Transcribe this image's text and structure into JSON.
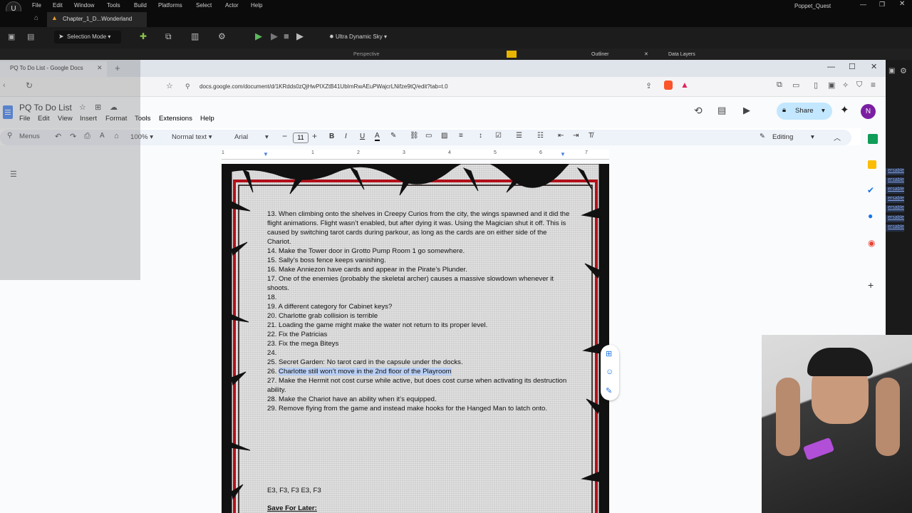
{
  "unreal": {
    "menu": [
      "File",
      "Edit",
      "Window",
      "Tools",
      "Build",
      "Platforms",
      "Select",
      "Actor",
      "Help"
    ],
    "tab_title": "Chapter_1_D...Wonderland",
    "project": "Poppet_Quest",
    "selection_mode": "Selection Mode",
    "sky": "Ultra Dynamic Sky",
    "perspective": "Perspective",
    "outliner": "Outliner",
    "data_layers": "Data Layers",
    "link_labels": [
      "ersable",
      "ersable",
      "ersable",
      "ersable",
      "ersable",
      "ersable",
      "ersable"
    ]
  },
  "browser": {
    "tab_title": "PQ To Do List - Google Docs",
    "url": "docs.google.com/document/d/1KRdds0zQjHwPIXZtB41UbImRwAEuPWajcrLNifze9tQ/edit?tab=t.0"
  },
  "docs": {
    "title": "PQ To Do List",
    "menu": [
      "File",
      "Edit",
      "View",
      "Insert",
      "Format",
      "Tools",
      "Extensions",
      "Help"
    ],
    "share": "Share",
    "avatar": "N",
    "menus": "Menus",
    "zoom": "100%",
    "style": "Normal text",
    "font": "Arial",
    "font_size": "11",
    "mode": "Editing",
    "ruler_numbers": [
      "1",
      "1",
      "2",
      "3",
      "4",
      "5",
      "6",
      "7"
    ]
  },
  "document": {
    "items": [
      "13. When climbing onto the shelves in Creepy Curios from the city, the wings spawned and it did the flight animations. Flight wasn’t enabled, but after dying it was. Using the Magician shut it off. This is caused by switching tarot cards during parkour, as long as the cards are on either side of the Chariot.",
      "14. Make the Tower door in Grotto Pump Room 1 go somewhere.",
      "15. Sally’s boss fence keeps vanishing.",
      "16. Make Anniezon have cards and appear in the Pirate’s Plunder.",
      "17. One of the enemies (probably the skeletal archer) causes a massive slowdown whenever it shoots.",
      "18.",
      "19. A different category for Cabinet keys?",
      "20. Charlotte grab collision is terrible",
      "21. Loading the game might make the water not return to its proper level.",
      "22. Fix the Patricias",
      "23. Fix the mega Biteys",
      "24.",
      "25. Secret Garden: No tarot card in the capsule under the docks.",
      "26.",
      "27. Make the Hermit not cost curse while active, but does cost curse when activating its destruction ability.",
      "28. Make the Chariot have an ability when it’s equipped.",
      "29. Remove flying from the game and instead make hooks for the Hanged Man to latch onto."
    ],
    "highlighted": "Charlotte still won’t move in the 2nd floor of the Playroom",
    "keys": "E3, F3,  F3  E3, F3",
    "save_later": "Save For Later:"
  }
}
